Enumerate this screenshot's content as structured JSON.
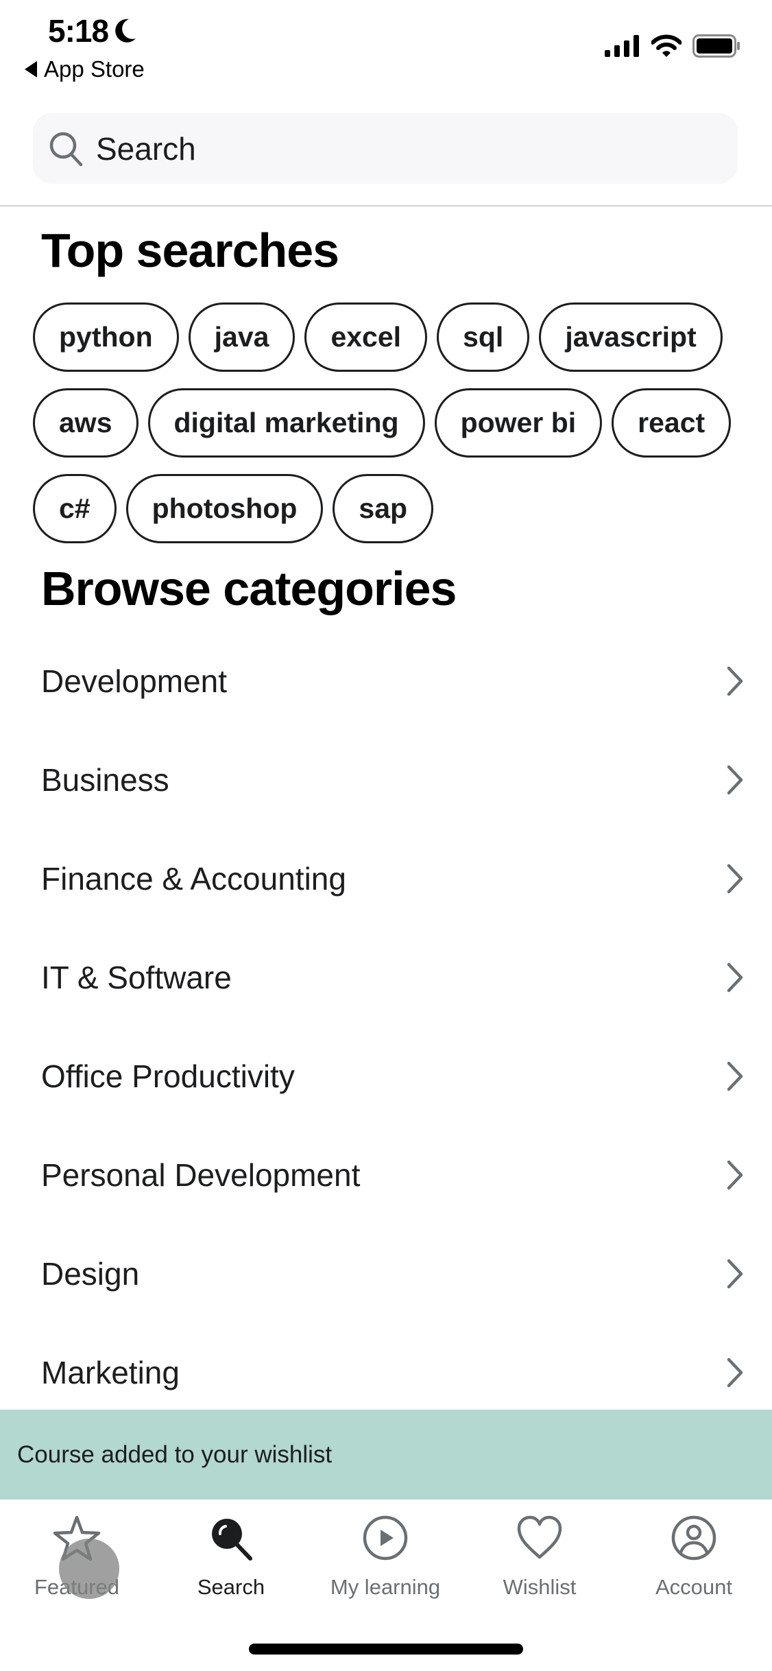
{
  "status_bar": {
    "time": "5:18",
    "back_app": "App Store"
  },
  "search": {
    "placeholder": "Search",
    "value": ""
  },
  "top_searches": {
    "title": "Top searches",
    "chips": [
      "python",
      "java",
      "excel",
      "sql",
      "javascript",
      "aws",
      "digital marketing",
      "power bi",
      "react",
      "c#",
      "photoshop",
      "sap"
    ]
  },
  "browse_categories": {
    "title": "Browse categories",
    "items": [
      "Development",
      "Business",
      "Finance & Accounting",
      "IT & Software",
      "Office Productivity",
      "Personal Development",
      "Design",
      "Marketing"
    ]
  },
  "toast": {
    "message": "Course added to your wishlist",
    "color": "#b2d8d0"
  },
  "tab_bar": {
    "active": "Search",
    "tabs": [
      {
        "label": "Featured",
        "icon": "star-icon"
      },
      {
        "label": "Search",
        "icon": "search-icon"
      },
      {
        "label": "My learning",
        "icon": "play-circle-icon"
      },
      {
        "label": "Wishlist",
        "icon": "heart-icon"
      },
      {
        "label": "Account",
        "icon": "account-icon"
      }
    ]
  }
}
